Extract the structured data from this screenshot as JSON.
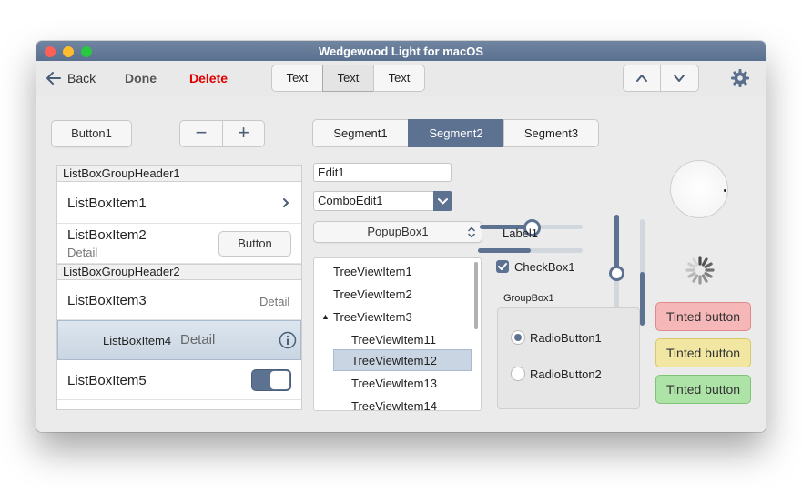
{
  "window": {
    "title": "Wedgewood Light for macOS"
  },
  "toolbar": {
    "back_label": "Back",
    "done_label": "Done",
    "delete_label": "Delete",
    "delete_color": "#e00000",
    "segments": [
      "Text",
      "Text",
      "Text"
    ],
    "selected_segment": 1
  },
  "buttons": {
    "button1": "Button1",
    "minus": "−",
    "plus": "+"
  },
  "segmented": {
    "items": [
      "Segment1",
      "Segment2",
      "Segment3"
    ],
    "selected": 1,
    "accent": "#5d7191"
  },
  "listbox": {
    "group1": "ListBoxGroupHeader1",
    "group2": "ListBoxGroupHeader2",
    "item1": "ListBoxItem1",
    "item2": "ListBoxItem2",
    "item2_detail": "Detail",
    "item2_button": "Button",
    "item3": "ListBoxItem3",
    "item3_detail": "Detail",
    "item4": "ListBoxItem4",
    "item4_detail": "Detail",
    "item5": "ListBoxItem5",
    "item5_toggle_on": true
  },
  "edit": {
    "value": "Edit1"
  },
  "combo": {
    "value": "ComboEdit1"
  },
  "popup": {
    "value": "PopupBox1"
  },
  "tree": {
    "items": [
      "TreeViewItem1",
      "TreeViewItem2",
      "TreeViewItem3",
      "TreeViewItem11",
      "TreeViewItem12",
      "TreeViewItem13",
      "TreeViewItem14"
    ],
    "selected": "TreeViewItem12"
  },
  "sliders": {
    "h1": 0.45,
    "h2": 0.5,
    "v1": 0.5,
    "v2": 0.5
  },
  "label1": "Label1",
  "checkbox": {
    "label": "CheckBox1",
    "checked": true
  },
  "groupbox": {
    "title": "GroupBox1",
    "radio1": "RadioButton1",
    "radio2": "RadioButton2",
    "selected": "RadioButton1"
  },
  "tinted": {
    "red": {
      "label": "Tinted button",
      "bg": "#f6b7b8",
      "border": "#e08a8c"
    },
    "yellow": {
      "label": "Tinted button",
      "bg": "#f2e7a2",
      "border": "#d9c86a"
    },
    "green": {
      "label": "Tinted button",
      "bg": "#aee3a8",
      "border": "#7fc377"
    }
  }
}
